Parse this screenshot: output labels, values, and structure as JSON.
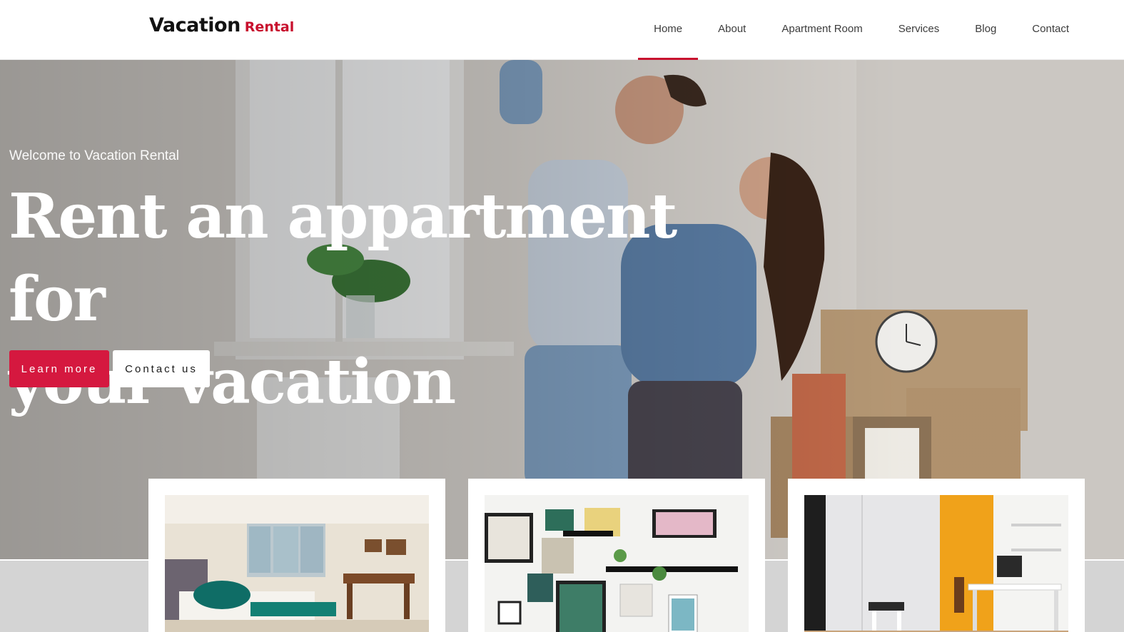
{
  "header": {
    "logo_main": "Vacation",
    "logo_accent": "Rental",
    "nav": [
      {
        "label": "Home",
        "active": true
      },
      {
        "label": "About",
        "active": false
      },
      {
        "label": "Apartment Room",
        "active": false
      },
      {
        "label": "Services",
        "active": false
      },
      {
        "label": "Blog",
        "active": false
      },
      {
        "label": "Contact",
        "active": false
      }
    ]
  },
  "hero": {
    "welcome": "Welcome to Vacation Rental",
    "headline_line1": "Rent an appartment for",
    "headline_line2": "your vacation",
    "primary_button": "Learn more",
    "secondary_button": "Contact us",
    "background_image": "family-moving-in-photo"
  },
  "cards": [
    {
      "image": "bedroom-photo"
    },
    {
      "image": "gallery-wall-photo"
    },
    {
      "image": "home-office-photo"
    }
  ],
  "colors": {
    "accent": "#c8102e",
    "button_primary": "#d5183f",
    "text_dark": "#121212"
  }
}
